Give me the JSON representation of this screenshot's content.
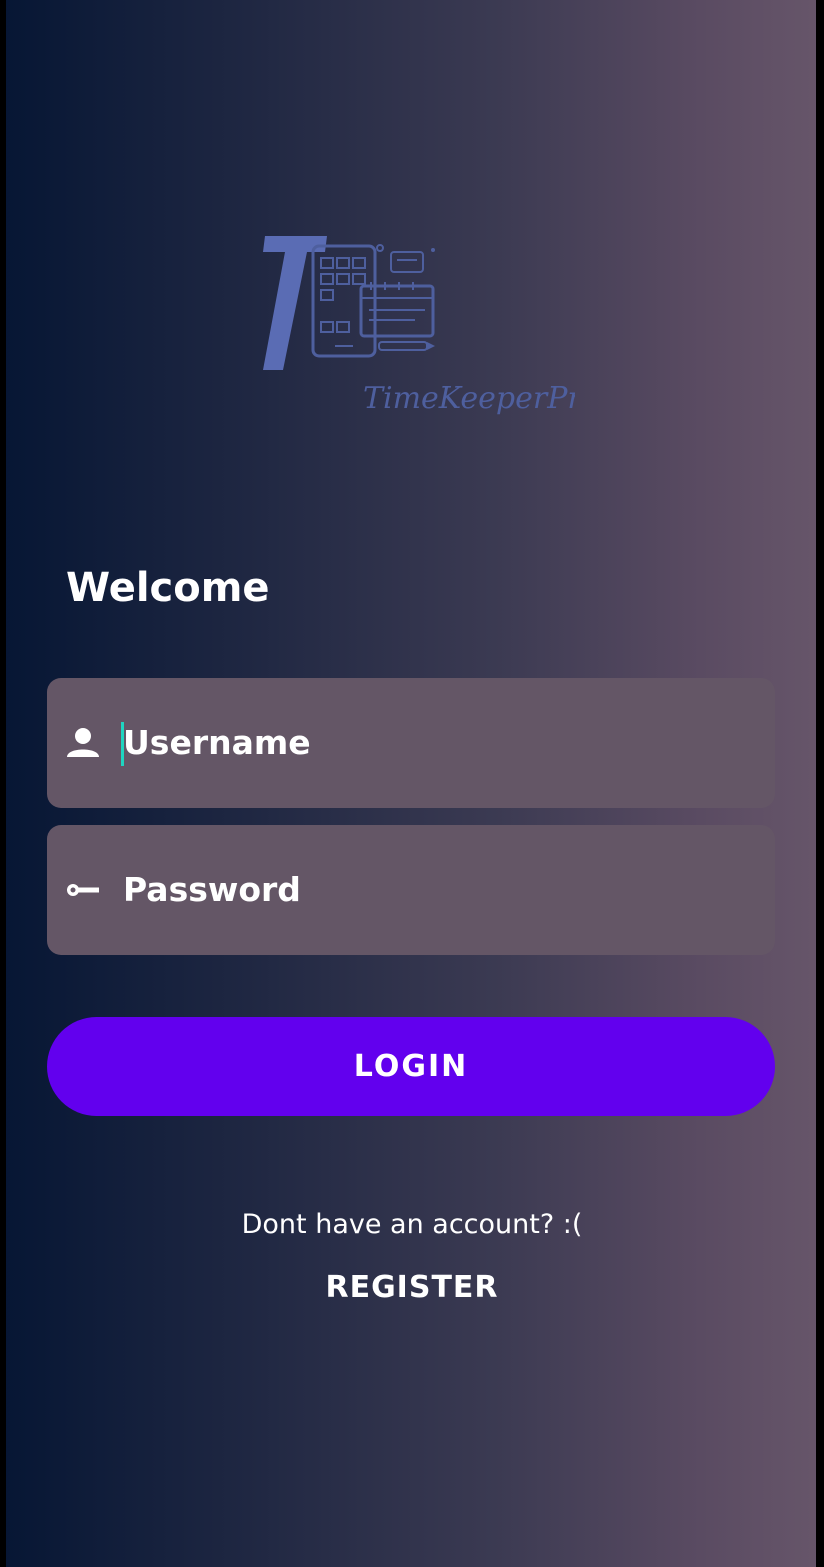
{
  "app": {
    "logo_text": "TimeKeeperPro",
    "logo_letter": "T"
  },
  "form": {
    "title": "Welcome",
    "username_placeholder": "Username",
    "password_placeholder": "Password",
    "login_label": "LOGIN"
  },
  "footer": {
    "register_prompt": "Dont have an account? :(",
    "register_label": "REGISTER"
  },
  "icons": {
    "username": "person-icon",
    "password": "key-icon"
  },
  "colors": {
    "accent": "#6200ee",
    "field_background": "#645666",
    "caret": "#1fd5c0",
    "logo": "#5a6cb4"
  }
}
